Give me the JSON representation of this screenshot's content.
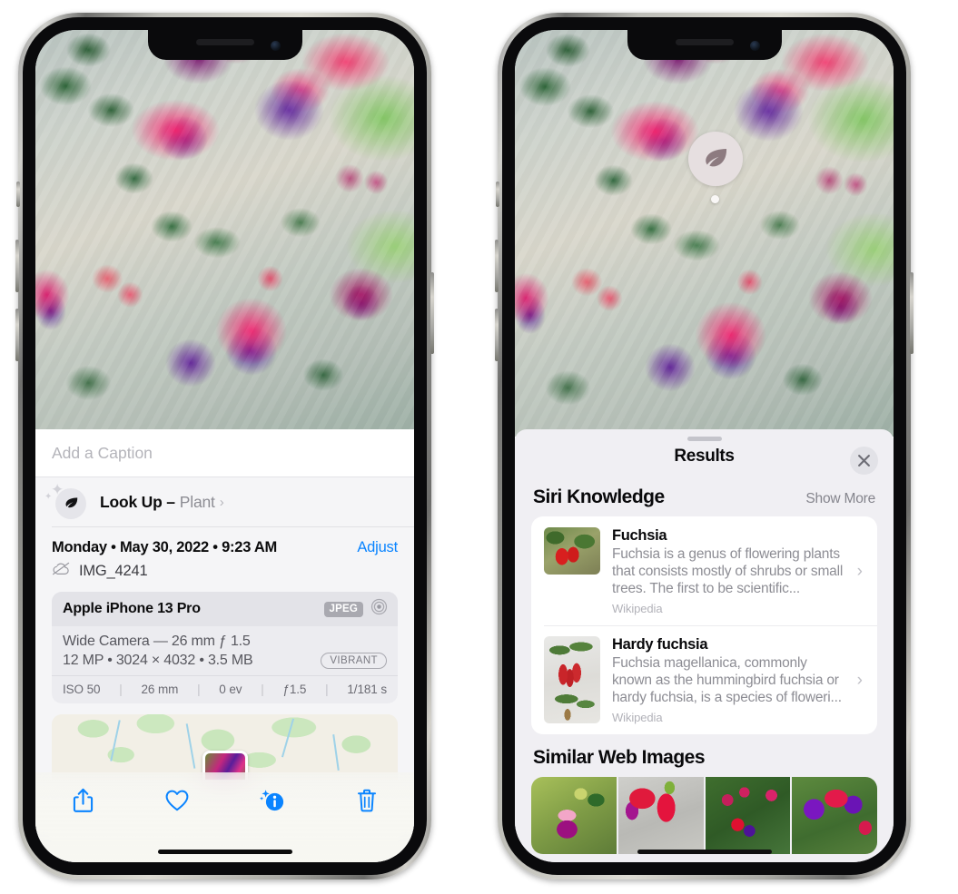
{
  "left_phone": {
    "photo": {
      "alt": "fuchsia-plant-photo"
    },
    "caption": {
      "placeholder": "Add a Caption",
      "value": ""
    },
    "lookup": {
      "title": "Look Up –",
      "subject": "Plant",
      "chevron": "›",
      "icon": "leaf-icon",
      "sparkle": "✦"
    },
    "metadata": {
      "date": "Monday • May 30, 2022 • 9:23 AM",
      "adjust_label": "Adjust",
      "filename": "IMG_4241",
      "cloud_icon": "cloud-slash-icon"
    },
    "camera_card": {
      "model": "Apple iPhone 13 Pro",
      "format_badge": "JPEG",
      "aperture_icon": "aperture-icon",
      "lens_line": "Wide Camera — 26 mm ƒ 1.5",
      "specs_line": "12 MP • 3024 × 4032 • 3.5 MB",
      "style_badge": "VIBRANT",
      "exif": [
        "ISO 50",
        "26 mm",
        "0 ev",
        "ƒ1.5",
        "1/181 s"
      ]
    },
    "toolbar": [
      {
        "name": "share-button",
        "icon": "share-icon"
      },
      {
        "name": "favorite-button",
        "icon": "heart-icon"
      },
      {
        "name": "info-button",
        "icon": "info-sparkle-icon"
      },
      {
        "name": "delete-button",
        "icon": "trash-icon"
      }
    ]
  },
  "right_phone": {
    "photo": {
      "alt": "fuchsia-plant-photo"
    },
    "leaf_badge": {
      "icon": "leaf-icon"
    },
    "results": {
      "title": "Results",
      "close_icon": "✕",
      "sections": [
        {
          "title": "Siri Knowledge",
          "action": "Show More",
          "items": [
            {
              "name": "Fuchsia",
              "description": "Fuchsia is a genus of flowering plants that consists mostly of shrubs or small trees. The first to be scientific...",
              "source": "Wikipedia",
              "chevron": "›"
            },
            {
              "name": "Hardy fuchsia",
              "description": "Fuchsia magellanica, commonly known as the hummingbird fuchsia or hardy fuchsia, is a species of floweri...",
              "source": "Wikipedia",
              "chevron": "›"
            }
          ]
        },
        {
          "title": "Similar Web Images",
          "action": "",
          "thumbs": [
            "web-image-1",
            "web-image-2",
            "web-image-3",
            "web-image-4"
          ]
        }
      ]
    }
  },
  "colors": {
    "accent_blue": "#0a84ff",
    "sheet_bg": "#f5f5f7",
    "results_bg": "#f0eff3",
    "card_bg": "#ffffff",
    "secondary_text": "#8d8d94"
  }
}
